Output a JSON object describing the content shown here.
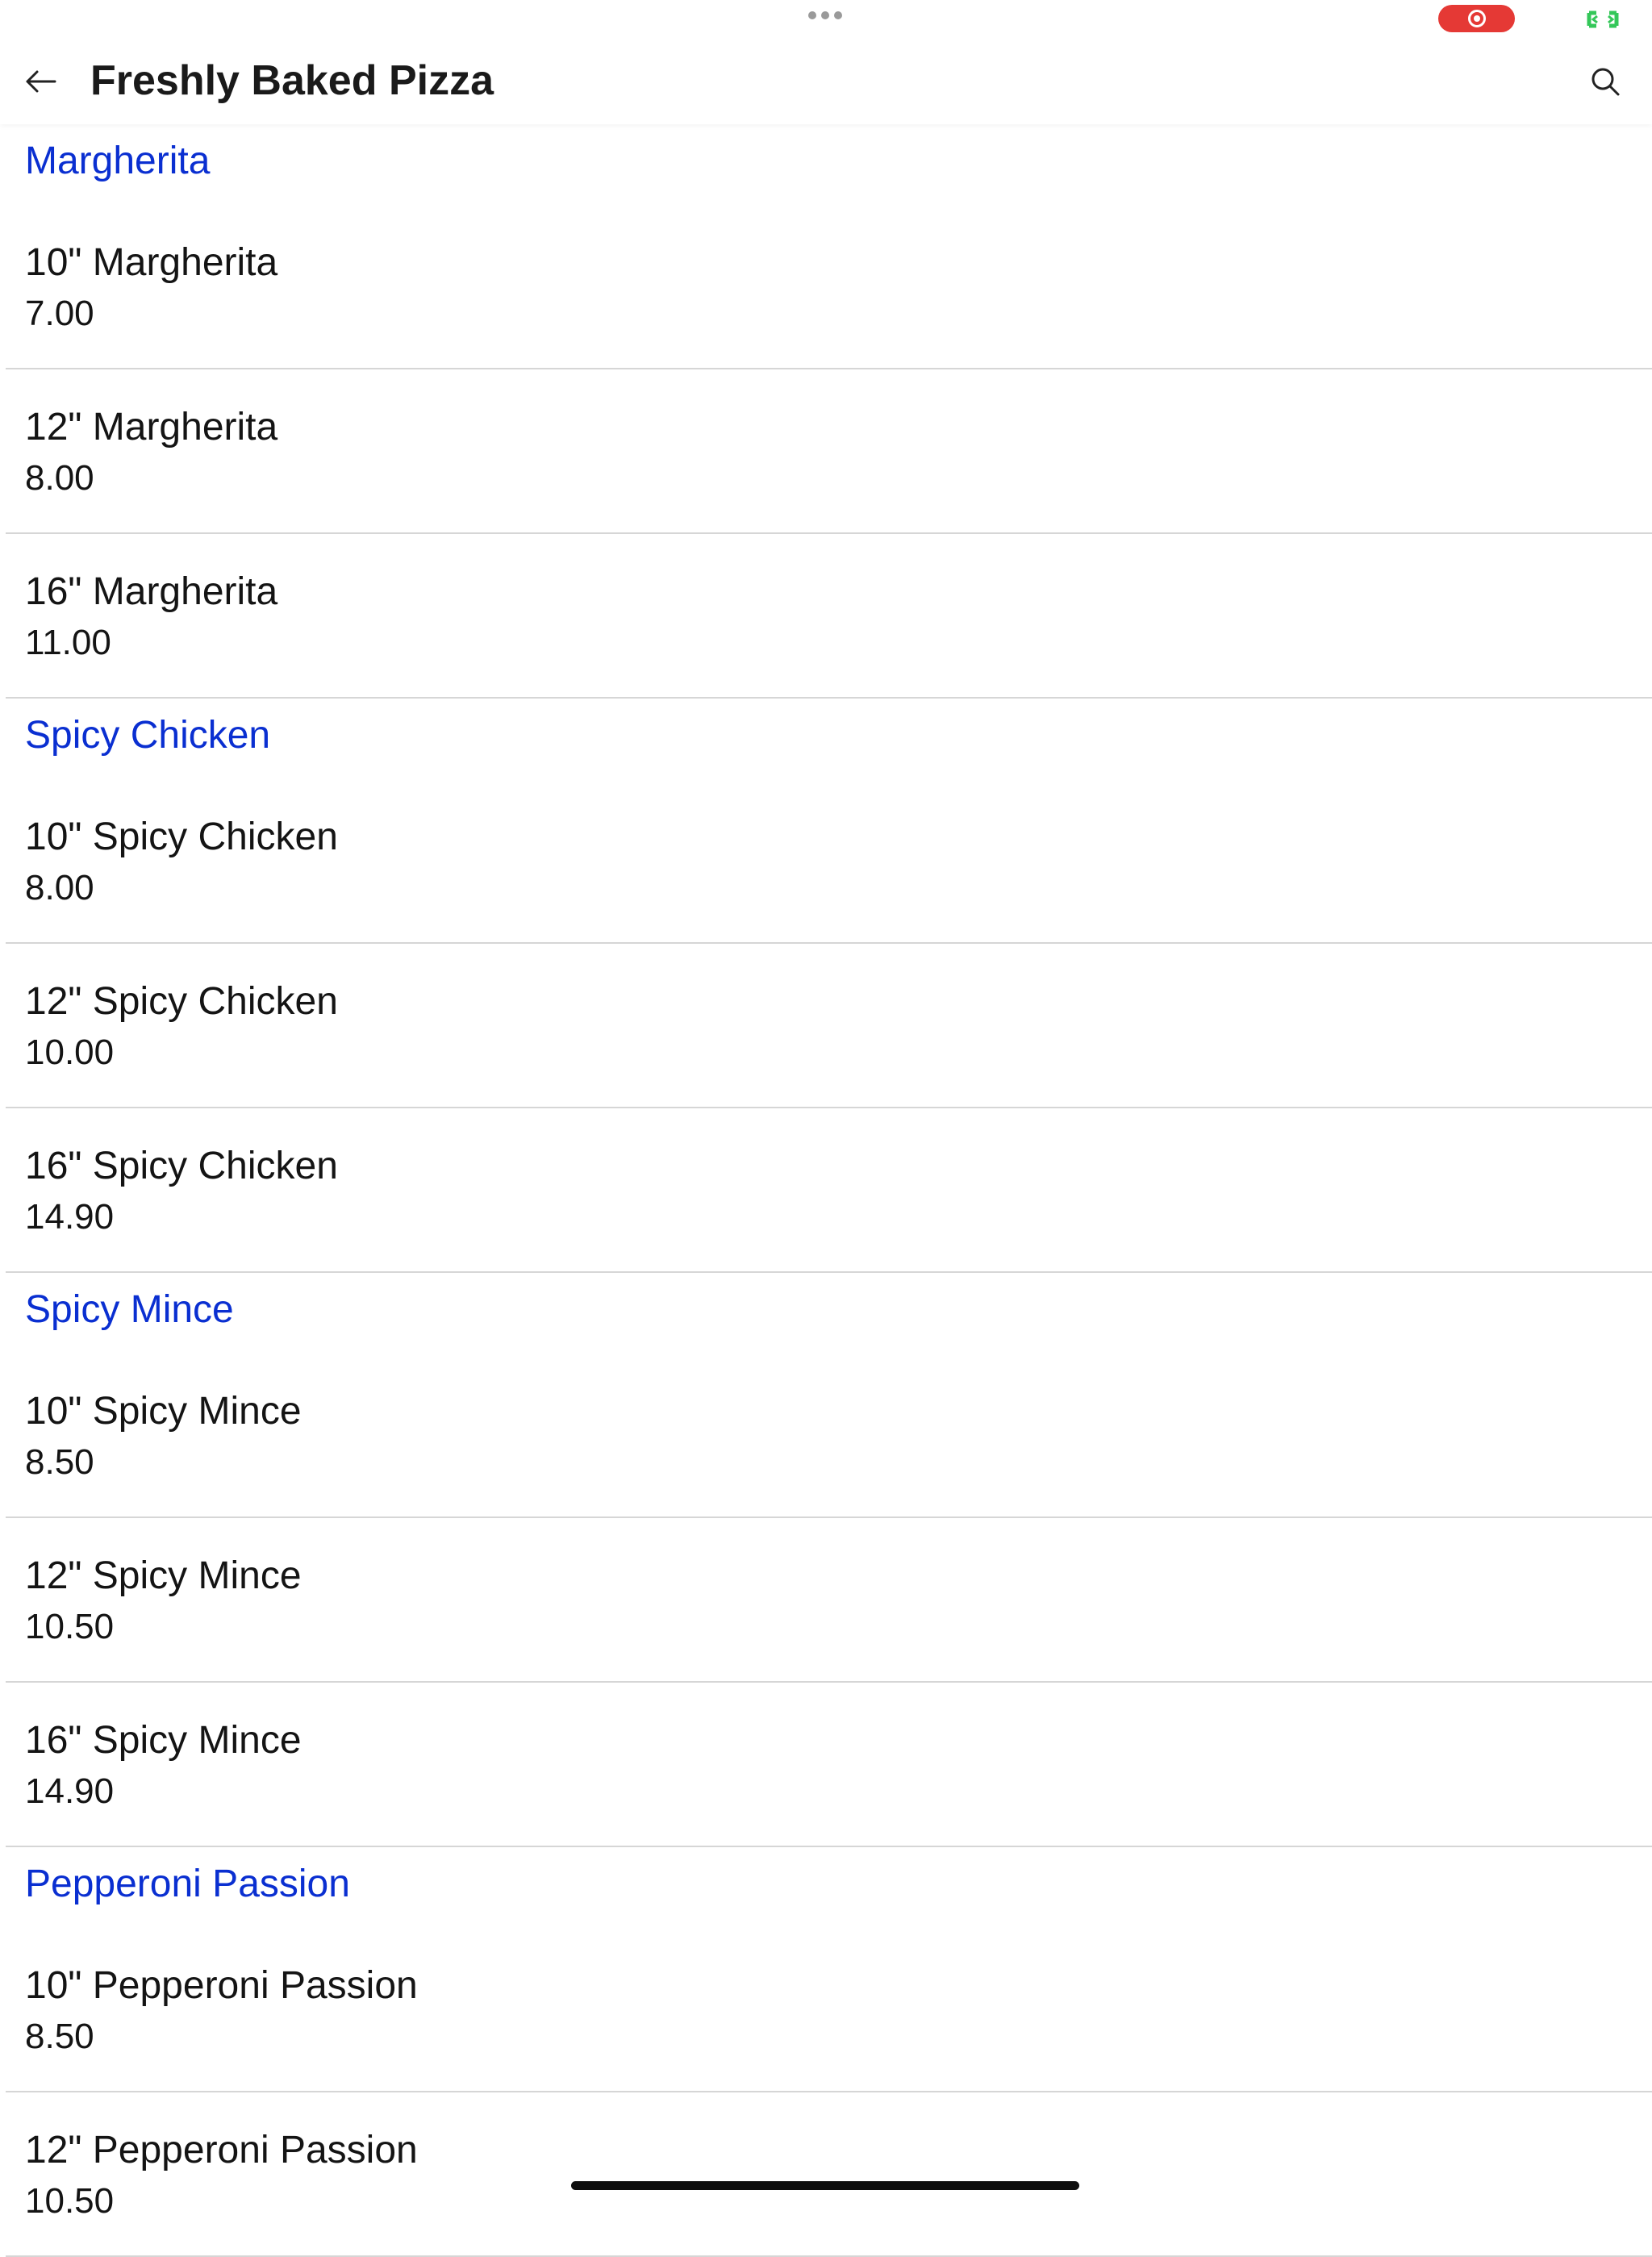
{
  "header": {
    "title": "Freshly Baked Pizza"
  },
  "colors": {
    "category": "#0a2fd1",
    "record": "#e53935",
    "screen_icon": "#34c759",
    "divider": "#d6d6d6"
  },
  "icons": {
    "back": "arrow-left-icon",
    "search": "search-icon",
    "record": "screen-record-icon",
    "screen": "fullscreen-icon"
  },
  "categories": [
    {
      "name": "Margherita",
      "items": [
        {
          "name": "10\" Margherita",
          "price": "7.00"
        },
        {
          "name": "12\" Margherita",
          "price": "8.00"
        },
        {
          "name": "16\" Margherita",
          "price": "11.00"
        }
      ]
    },
    {
      "name": "Spicy Chicken",
      "items": [
        {
          "name": "10\" Spicy Chicken",
          "price": "8.00"
        },
        {
          "name": "12\" Spicy Chicken",
          "price": "10.00"
        },
        {
          "name": "16\" Spicy Chicken",
          "price": "14.90"
        }
      ]
    },
    {
      "name": "Spicy Mince",
      "items": [
        {
          "name": "10\" Spicy Mince",
          "price": "8.50"
        },
        {
          "name": "12\" Spicy Mince",
          "price": "10.50"
        },
        {
          "name": "16\" Spicy Mince",
          "price": "14.90"
        }
      ]
    },
    {
      "name": "Pepperoni Passion",
      "items": [
        {
          "name": "10\" Pepperoni Passion",
          "price": "8.50"
        },
        {
          "name": "12\" Pepperoni Passion",
          "price": "10.50"
        }
      ]
    }
  ]
}
